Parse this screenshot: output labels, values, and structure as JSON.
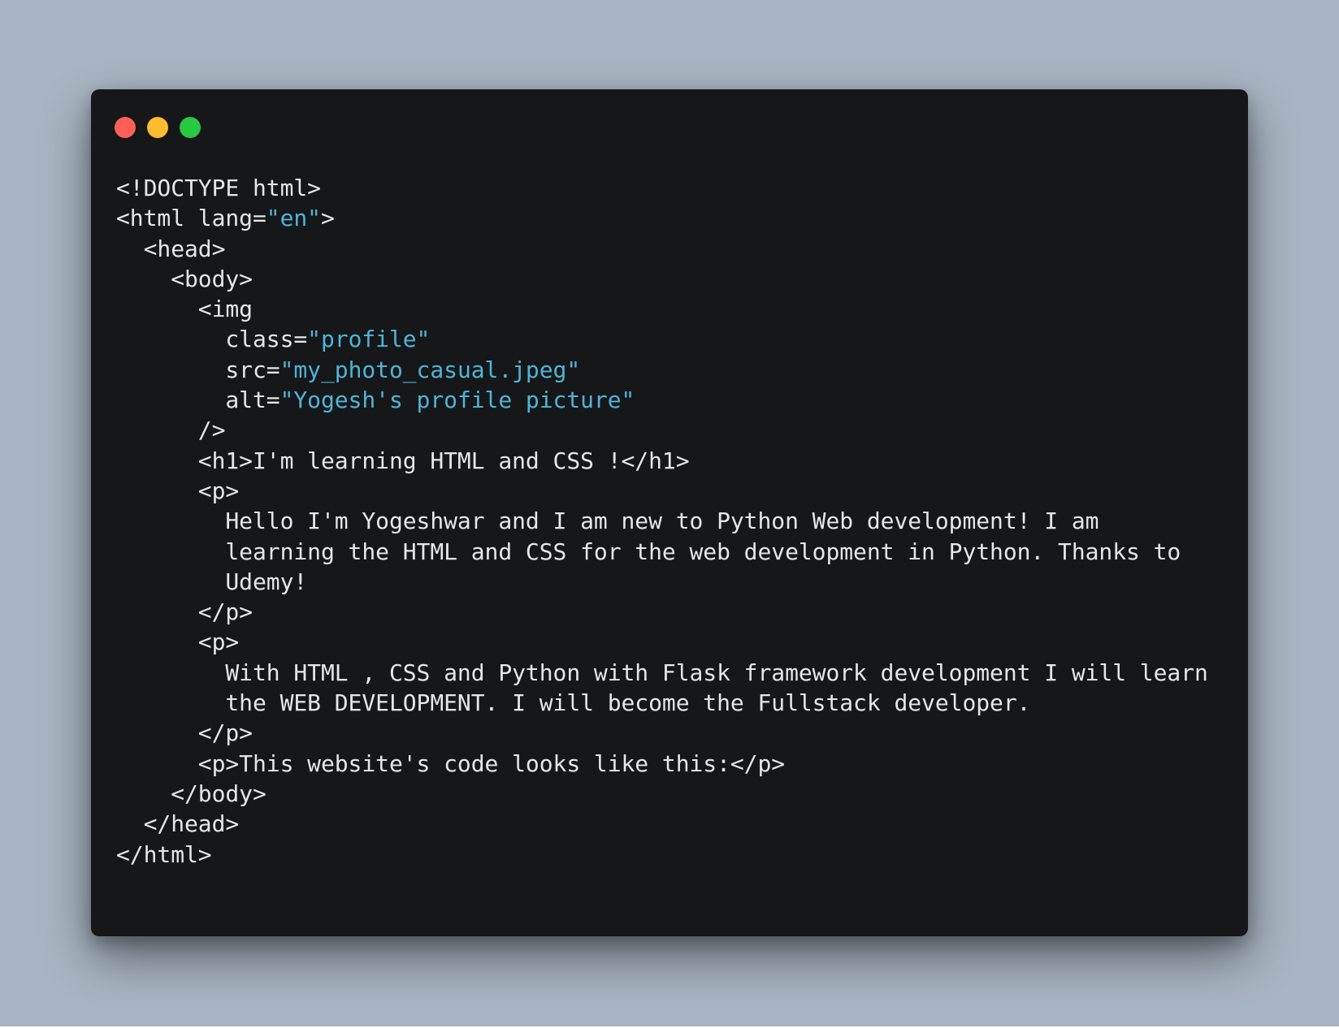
{
  "window": {
    "controls": [
      {
        "name": "close",
        "color": "#ff5f57"
      },
      {
        "name": "minimize",
        "color": "#febc2e"
      },
      {
        "name": "zoom",
        "color": "#28c840"
      }
    ]
  },
  "code": {
    "colors": {
      "text": "#e6e6e6",
      "string": "#4fb4d8",
      "background": "#161719"
    },
    "lines": [
      [
        {
          "t": "plain",
          "v": "<!DOCTYPE html>"
        }
      ],
      [
        {
          "t": "plain",
          "v": "<html lang="
        },
        {
          "t": "str",
          "v": "\"en\""
        },
        {
          "t": "plain",
          "v": ">"
        }
      ],
      [
        {
          "t": "plain",
          "v": "  <head>"
        }
      ],
      [
        {
          "t": "plain",
          "v": "    <body>"
        }
      ],
      [
        {
          "t": "plain",
          "v": "      <img"
        }
      ],
      [
        {
          "t": "plain",
          "v": "        class="
        },
        {
          "t": "str",
          "v": "\"profile\""
        }
      ],
      [
        {
          "t": "plain",
          "v": "        src="
        },
        {
          "t": "str",
          "v": "\"my_photo_casual.jpeg\""
        }
      ],
      [
        {
          "t": "plain",
          "v": "        alt="
        },
        {
          "t": "str",
          "v": "\"Yogesh's profile picture\""
        }
      ],
      [
        {
          "t": "plain",
          "v": "      />"
        }
      ],
      [
        {
          "t": "plain",
          "v": "      <h1>I'm learning HTML and CSS !</h1>"
        }
      ],
      [
        {
          "t": "plain",
          "v": "      <p>"
        }
      ],
      [
        {
          "t": "plain",
          "v": "        Hello I'm Yogeshwar and I am new to Python Web development! I am"
        }
      ],
      [
        {
          "t": "plain",
          "v": "        learning the HTML and CSS for the web development in Python. Thanks to"
        }
      ],
      [
        {
          "t": "plain",
          "v": "        Udemy!"
        }
      ],
      [
        {
          "t": "plain",
          "v": "      </p>"
        }
      ],
      [
        {
          "t": "plain",
          "v": "      <p>"
        }
      ],
      [
        {
          "t": "plain",
          "v": "        With HTML , CSS and Python with Flask framework development I will learn"
        }
      ],
      [
        {
          "t": "plain",
          "v": "        the WEB DEVELOPMENT. I will become the Fullstack developer."
        }
      ],
      [
        {
          "t": "plain",
          "v": "      </p>"
        }
      ],
      [
        {
          "t": "plain",
          "v": "      <p>This website's code looks like this:</p>"
        }
      ],
      [
        {
          "t": "plain",
          "v": "    </body>"
        }
      ],
      [
        {
          "t": "plain",
          "v": "  </head>"
        }
      ],
      [
        {
          "t": "plain",
          "v": "</html>"
        }
      ]
    ]
  }
}
